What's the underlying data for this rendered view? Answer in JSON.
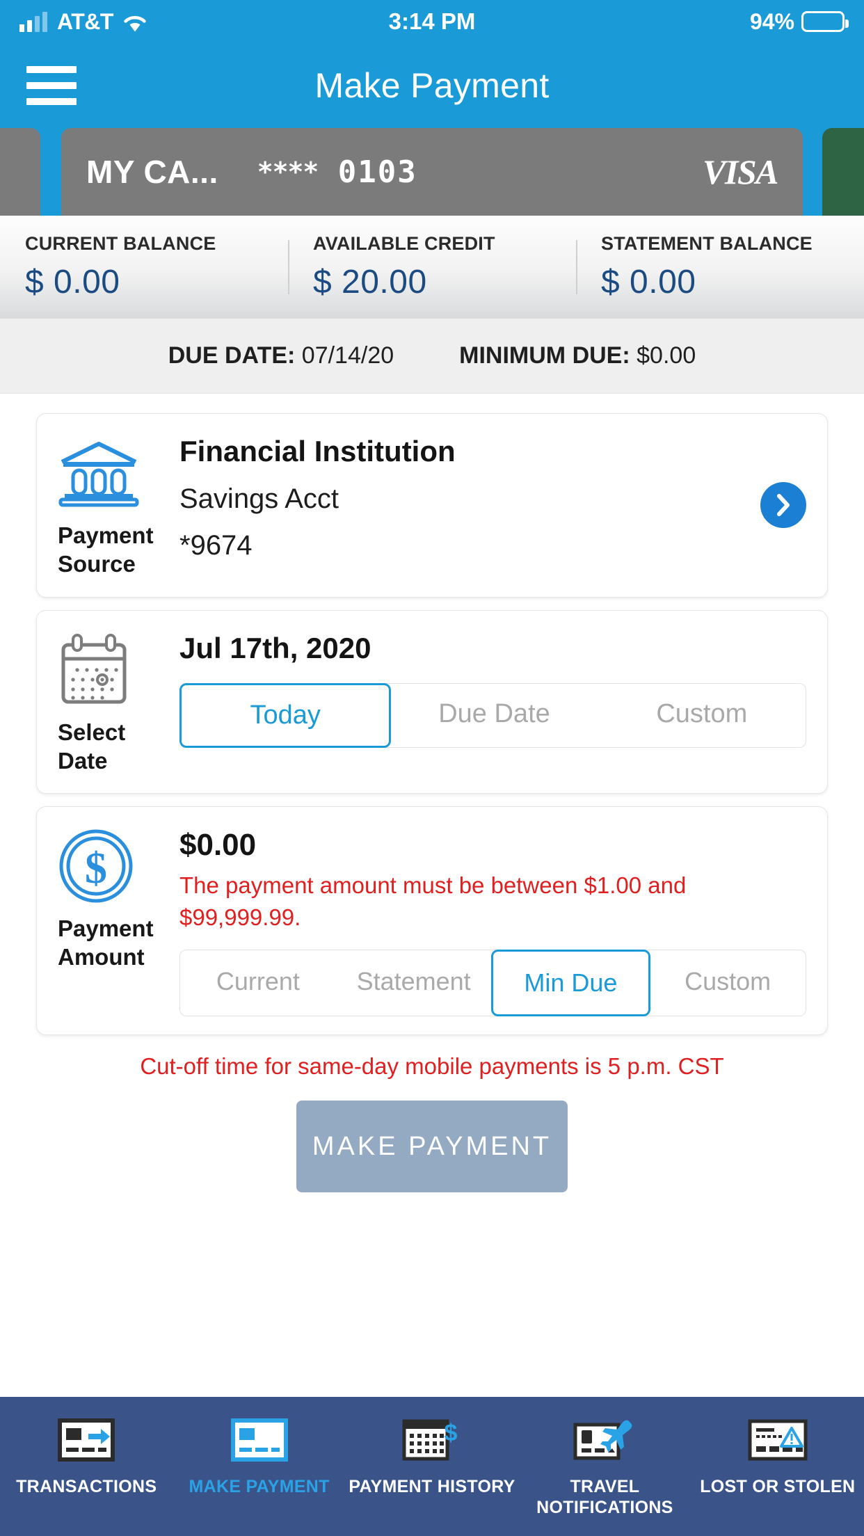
{
  "status_bar": {
    "carrier": "AT&T",
    "time": "3:14 PM",
    "battery_pct": "94%",
    "signal_icon": "signal-bars-icon",
    "wifi_icon": "wifi-icon",
    "battery_icon": "battery-icon"
  },
  "nav": {
    "title": "Make Payment",
    "menu_icon": "hamburger-menu-icon"
  },
  "card_carousel": {
    "active_card": {
      "nickname": "MY CA...",
      "mask": "****",
      "last_four": "0103",
      "network": "VISA",
      "color": "#7b7b7b"
    },
    "peek_left_color": "#7b7b7b",
    "peek_right_color": "#2e6443"
  },
  "balances": [
    {
      "label": "CURRENT BALANCE",
      "value": "$ 0.00"
    },
    {
      "label": "AVAILABLE CREDIT",
      "value": "$ 20.00"
    },
    {
      "label": "STATEMENT BALANCE",
      "value": "$ 0.00"
    }
  ],
  "due_row": {
    "due_date_label": "DUE DATE:",
    "due_date_value": "07/14/20",
    "minimum_due_label": "MINIMUM DUE:",
    "minimum_due_value": "$0.00"
  },
  "payment_source": {
    "icon": "bank-icon",
    "label": "Payment Source",
    "label_line1": "Payment",
    "label_line2": "Source",
    "institution": "Financial Institution",
    "account_type": "Savings Acct",
    "account_mask": "*9674",
    "chevron_icon": "chevron-right-icon"
  },
  "select_date": {
    "icon": "calendar-icon",
    "label": "Select Date",
    "date": "Jul 17th, 2020",
    "options": [
      {
        "label": "Today",
        "selected": true
      },
      {
        "label": "Due Date",
        "selected": false
      },
      {
        "label": "Custom",
        "selected": false
      }
    ]
  },
  "payment_amount": {
    "icon": "dollar-coin-icon",
    "label": "Payment Amount",
    "label_line1": "Payment",
    "label_line2": "Amount",
    "amount": "$0.00",
    "error": "The payment amount must be between $1.00 and $99,999.99.",
    "options": [
      {
        "label": "Current",
        "selected": false
      },
      {
        "label": "Statement",
        "selected": false
      },
      {
        "label": "Min Due",
        "selected": true
      },
      {
        "label": "Custom",
        "selected": false
      }
    ]
  },
  "cutoff_notice": "Cut-off time for same-day mobile payments is 5 p.m. CST",
  "submit_button": {
    "label": "MAKE PAYMENT",
    "enabled": false
  },
  "tab_bar": {
    "items": [
      {
        "label": "TRANSACTIONS",
        "icon": "card-arrow-icon",
        "active": false
      },
      {
        "label": "MAKE PAYMENT",
        "icon": "card-payment-icon",
        "active": true
      },
      {
        "label": "PAYMENT HISTORY",
        "icon": "calendar-dollar-icon",
        "active": false
      },
      {
        "label": "TRAVEL NOTIFICATIONS",
        "icon": "card-airplane-icon",
        "active": false
      },
      {
        "label": "LOST OR STOLEN",
        "icon": "card-warning-icon",
        "active": false
      }
    ]
  },
  "colors": {
    "brand_blue": "#1b9ad8",
    "accent_blue": "#1b7fd4",
    "navy": "#1c4b82",
    "tabbar_navy": "#3a5489",
    "error_red": "#e02020",
    "disabled_button": "#94aac3"
  }
}
